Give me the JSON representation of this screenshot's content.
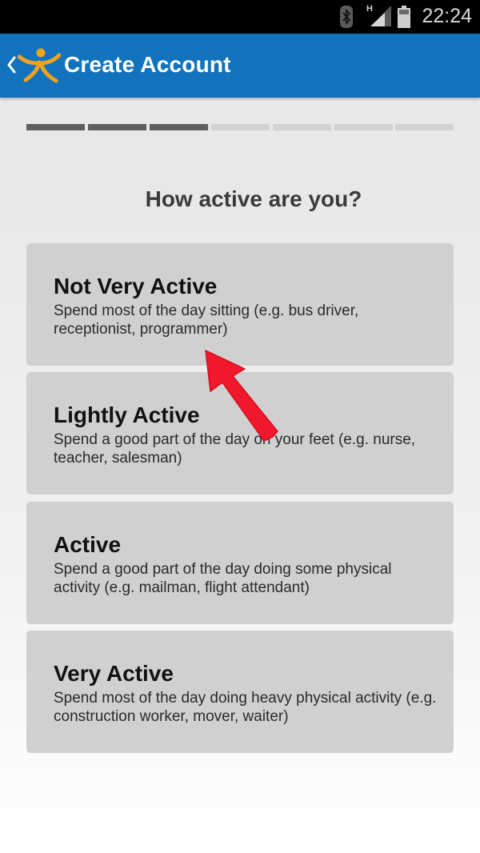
{
  "status_bar": {
    "network_label": "H",
    "time": "22:24",
    "icons": [
      "bluetooth-icon",
      "signal-icon",
      "battery-icon"
    ]
  },
  "app_bar": {
    "title": "Create Account",
    "back_icon": "chevron-left-icon",
    "logo_icon": "figure-logo-icon",
    "color": "#1173bd"
  },
  "progress": {
    "steps_total": 7,
    "steps_completed": 3
  },
  "question": "How active are you?",
  "options": [
    {
      "title": "Not Very Active",
      "description": "Spend most of the day sitting (e.g. bus driver, receptionist, programmer)"
    },
    {
      "title": "Lightly Active",
      "description": "Spend a good part of the day on your feet (e.g. nurse, teacher, salesman)"
    },
    {
      "title": "Active",
      "description": "Spend a good part of the day doing some physical activity (e.g. mailman, flight attendant)"
    },
    {
      "title": "Very Active",
      "description": "Spend most of the day doing heavy physical activity (e.g. construction worker, mover, waiter)"
    }
  ],
  "annotation": {
    "icon": "red-arrow-icon",
    "color": "#f0182a"
  }
}
